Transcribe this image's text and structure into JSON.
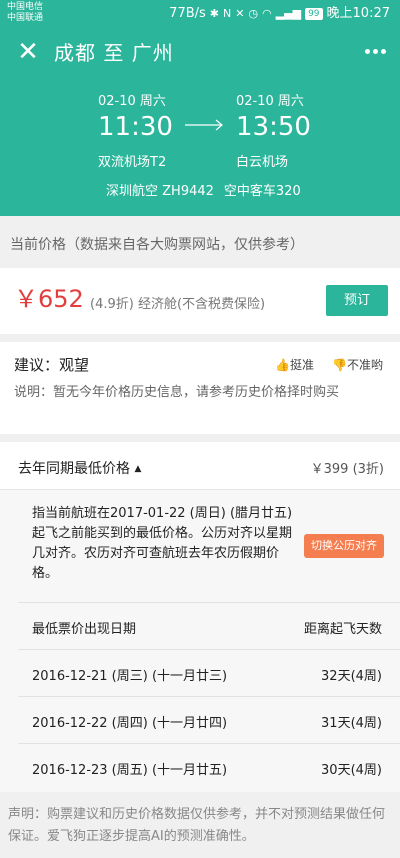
{
  "status_bar": {
    "carrier1": "中国电信",
    "carrier2": "中国联通",
    "speed": "77B/s",
    "battery": "99",
    "time": "晚上10:27"
  },
  "header": {
    "route": "成都 至 广州",
    "departure": {
      "date": "02-10 周六",
      "time": "11:30",
      "airport": "双流机场T2"
    },
    "arrival": {
      "date": "02-10 周六",
      "time": "13:50",
      "airport": "白云机场"
    },
    "flight": "深圳航空 ZH9442",
    "aircraft": "空中客车320"
  },
  "price_section": {
    "label": "当前价格（数据来自各大购票网站，仅供参考）",
    "price": "￥652",
    "description": "(4.9折) 经济舱(不含税费保险)",
    "book_label": "预订"
  },
  "advice": {
    "title": "建议：观望",
    "vote_accurate": "挺准",
    "vote_inaccurate": "不准哟",
    "note": "说明：暂无今年价格历史信息，请参考历史价格择时购买"
  },
  "history": {
    "title": "去年同期最低价格",
    "value": "￥399 (3折)",
    "explain": "指当前航班在2017-01-22 (周日) (腊月廿五)起飞之前能买到的最低价格。公历对齐以星期几对齐。农历对齐可查航班去年农历假期价格。",
    "switch_label": "切换公历对齐",
    "table_header": {
      "col1": "最低票价出现日期",
      "col2": "距离起飞天数"
    },
    "rows": [
      {
        "date": "2016-12-21 (周三) (十一月廿三)",
        "days": "32天(4周)"
      },
      {
        "date": "2016-12-22 (周四) (十一月廿四)",
        "days": "31天(4周)"
      },
      {
        "date": "2016-12-23 (周五) (十一月廿五)",
        "days": "30天(4周)"
      }
    ]
  },
  "disclaimer": "声明：购票建议和历史价格数据仅供参考，并不对预测结果做任何保证。爱飞狗正逐步提高AI的预测准确性。",
  "colors": {
    "accent": "#2bb59a",
    "price": "#e23e3e",
    "switch": "#f47e50"
  }
}
